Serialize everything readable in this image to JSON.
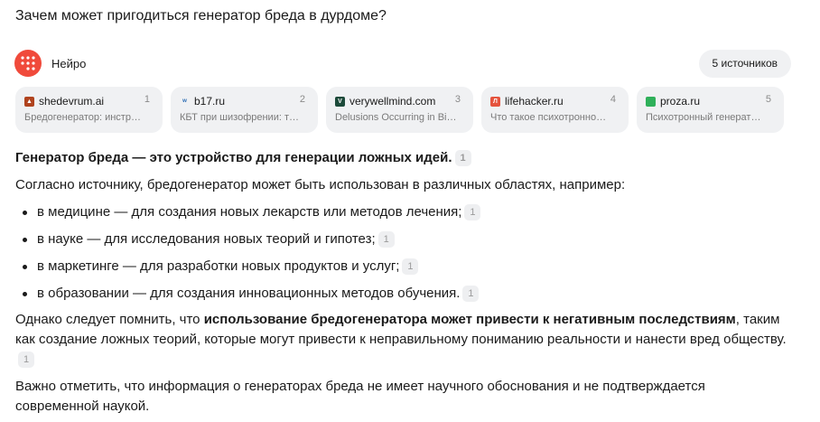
{
  "question": "Зачем может пригодиться генератор бреда в дурдоме?",
  "header": {
    "brand": "Нейро",
    "sources_button": "5 источников",
    "brand_color": "#f04a3b"
  },
  "sources": [
    {
      "domain": "shedevrum.ai",
      "num": "1",
      "snippet": "Бредогенератор: инстр…",
      "icon": "shedevrum-icon",
      "color": "#b0431e"
    },
    {
      "domain": "b17.ru",
      "num": "2",
      "snippet": "КБТ при шизофрении: т…",
      "icon": "b17-icon",
      "color": "#2f6fb5"
    },
    {
      "domain": "verywellmind.com",
      "num": "3",
      "snippet": "Delusions Occurring in Bi…",
      "icon": "verywellmind-icon",
      "color": "#1c4a3a"
    },
    {
      "domain": "lifehacker.ru",
      "num": "4",
      "snippet": "Что такое психотронно…",
      "icon": "lifehacker-icon",
      "color": "#e5533d"
    },
    {
      "domain": "proza.ru",
      "num": "5",
      "snippet": "Психотронный генерат…",
      "icon": "proza-icon",
      "color": "#2fb05a"
    }
  ],
  "answer": {
    "p1": "Генератор бреда — это устройство для генерации ложных идей.",
    "p1_cite": "1",
    "p2": "Согласно источнику, бредогенератор может быть использован в различных областях, например:",
    "items": [
      {
        "text": "в медицине — для создания новых лекарств или методов лечения;",
        "cite": "1"
      },
      {
        "text": "в науке — для исследования новых теорий и гипотез;",
        "cite": "1"
      },
      {
        "text": "в маркетинге — для разработки новых продуктов и услуг;",
        "cite": "1"
      },
      {
        "text": "в образовании — для создания инновационных методов обучения.",
        "cite": "1"
      }
    ],
    "p3_pre": "Однако следует помнить, что ",
    "p3_bold": "использование бредогенератора может привести к негативным последствиям",
    "p3_post": ", таким как создание ложных теорий, которые могут привести к неправильному пониманию реальности и нанести вред обществу.",
    "p3_cite": "1",
    "p4": "Важно отметить, что информация о генераторах бреда не имеет научного обоснования и не подтверждается современной наукой."
  }
}
